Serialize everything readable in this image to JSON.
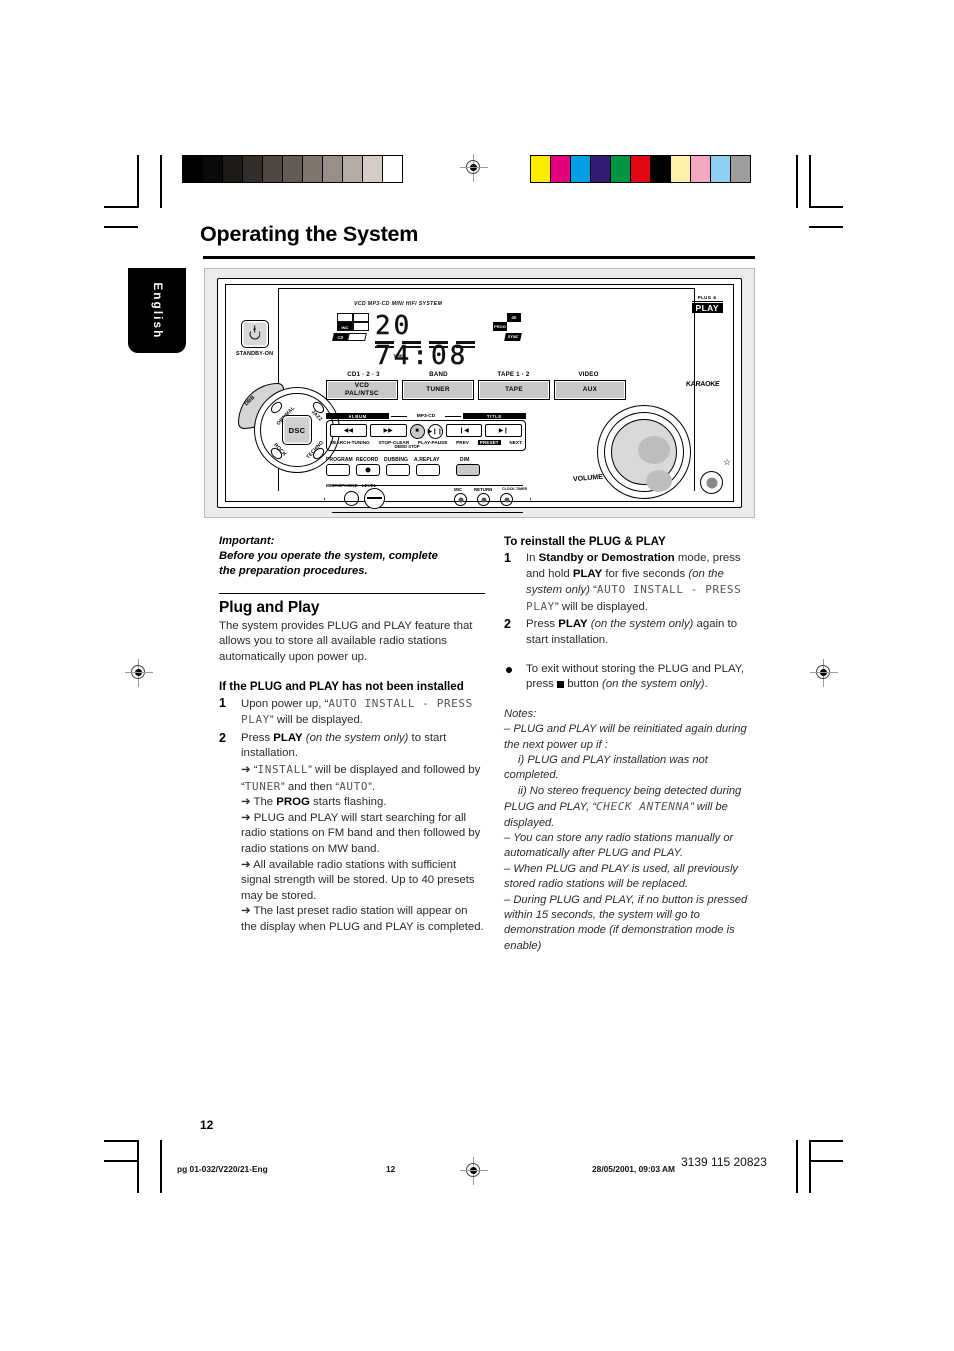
{
  "page": {
    "title": "Operating the System",
    "language_tab": "English",
    "folio": "12"
  },
  "printer_marks": {
    "grayscale_swatches": [
      "#000000",
      "#0b0a09",
      "#1d1a17",
      "#332e2a",
      "#4f4741",
      "#645b54",
      "#7e756d",
      "#998f87",
      "#b5aca4",
      "#d4cdc6",
      "#ffffff"
    ],
    "color_swatches": [
      "#fced00",
      "#e5007d",
      "#009fe3",
      "#311b74",
      "#009640",
      "#e30613",
      "#000000",
      "#fbf0a8",
      "#f6a8c0",
      "#8ed0f0",
      "#9d9d9c"
    ]
  },
  "device": {
    "system_label": "VCD MP3-CD MINI HIFI SYSTEM",
    "plug_play_logo_top": "PLUG &",
    "plug_play_logo_main": "PLAY",
    "karaoke_label": "KARAOKE",
    "standby_label": "STANDBY-ON",
    "display": {
      "track": "20",
      "time": "74:08",
      "timer_label": "TIMER",
      "icon_left_top": "INC",
      "icon_left_bottom": "CD",
      "icon_right_top": "PROG",
      "icon_right_corner": "4X",
      "icon_right_bottom": "SYNC"
    },
    "source_headers": [
      "CD1 · 2 · 3",
      "BAND",
      "TAPE 1 · 2",
      "VIDEO"
    ],
    "source_buttons": [
      "VCD\nPAL/NTSC",
      "TUNER",
      "TAPE",
      "AUX"
    ],
    "dsc": {
      "center": "DSC",
      "dbb": "DBB",
      "modes": [
        "OPTIMAL",
        "JAZZ",
        "ROCK",
        "TECHNO"
      ]
    },
    "transport": {
      "album_label": "ALBUM",
      "mp3cd_label": "MP3-CD",
      "title_label": "TITLE",
      "labels": [
        "SEARCH-TUNING",
        "STOP-CLEAR",
        "PLAY-PAUSE",
        "PREV",
        "NEXT"
      ],
      "sub_label": "DEMO STOP",
      "prev_next_mid": "PRESET"
    },
    "functions": [
      "PROGRAM",
      "RECORD",
      "DUBBING",
      "A.REPLAY",
      "DIM"
    ],
    "microphone_label": "MICROPHONE - LEVEL",
    "jack_labels": [
      "MIC",
      "RETURN",
      "CLOCK-TIMER"
    ],
    "volume_label": "VOLUME"
  },
  "left_column": {
    "important_lines": [
      "Important:",
      "Before you operate the system, complete",
      "the preparation procedures."
    ],
    "section_title": "Plug and Play",
    "intro": "The system provides PLUG and PLAY feature that allows you to store all available radio stations automatically upon power up.",
    "subheading": "If the PLUG and PLAY has not been installed",
    "steps": [
      {
        "num": "1",
        "parts": [
          {
            "t": "Upon power up, “",
            "s": "plain"
          },
          {
            "t": "AUTO INSTALL - PRESS PLAY",
            "s": "lcd"
          },
          {
            "t": "” will be displayed.",
            "s": "plain"
          }
        ]
      },
      {
        "num": "2",
        "parts": [
          {
            "t": "Press ",
            "s": "plain"
          },
          {
            "t": "PLAY",
            "s": "bold"
          },
          {
            "t": " (on the system only)",
            "s": "ital"
          },
          {
            "t": " to start installation.",
            "s": "plain"
          }
        ]
      }
    ],
    "arrows": [
      [
        {
          "t": "➔ “",
          "s": "plain"
        },
        {
          "t": "INSTALL",
          "s": "lcd"
        },
        {
          "t": "” will be displayed and followed by “",
          "s": "plain"
        },
        {
          "t": "TUNER",
          "s": "lcd"
        },
        {
          "t": "” and then “",
          "s": "plain"
        },
        {
          "t": "AUTO",
          "s": "lcd"
        },
        {
          "t": "”.",
          "s": "plain"
        }
      ],
      [
        {
          "t": "➔ The ",
          "s": "plain"
        },
        {
          "t": "PROG",
          "s": "bold"
        },
        {
          "t": " starts flashing.",
          "s": "plain"
        }
      ],
      [
        {
          "t": "➔ PLUG and PLAY will start searching for all radio stations on FM band and then followed by radio stations on MW band.",
          "s": "plain"
        }
      ],
      [
        {
          "t": "➔ All available radio stations with sufficient signal strength will be stored. Up to 40 presets may be stored.",
          "s": "plain"
        }
      ],
      [
        {
          "t": "➔ The last preset radio station will appear on the display when PLUG and PLAY is completed.",
          "s": "plain"
        }
      ]
    ]
  },
  "right_column": {
    "subheading": "To reinstall the PLUG & PLAY",
    "steps": [
      {
        "num": "1",
        "parts": [
          {
            "t": "In ",
            "s": "plain"
          },
          {
            "t": "Standby or Demostration",
            "s": "bold"
          },
          {
            "t": " mode, press and hold ",
            "s": "plain"
          },
          {
            "t": "PLAY",
            "s": "bold"
          },
          {
            "t": " for five seconds ",
            "s": "plain"
          },
          {
            "t": "(on the system only)",
            "s": "ital"
          },
          {
            "t": " “",
            "s": "plain"
          },
          {
            "t": "AUTO INSTALL - PRESS PLAY",
            "s": "lcd"
          },
          {
            "t": "” will be displayed.",
            "s": "plain"
          }
        ]
      },
      {
        "num": "2",
        "parts": [
          {
            "t": "Press ",
            "s": "plain"
          },
          {
            "t": "PLAY",
            "s": "bold"
          },
          {
            "t": " (on the system only)",
            "s": "ital"
          },
          {
            "t": " again to start installation.",
            "s": "plain"
          }
        ]
      }
    ],
    "bullet": [
      {
        "t": "To exit without storing the PLUG and PLAY, press ",
        "s": "plain"
      },
      {
        "t": "■",
        "s": "glyph"
      },
      {
        "t": " button ",
        "s": "plain"
      },
      {
        "t": "(on the system only)",
        "s": "ital"
      },
      {
        "t": ".",
        "s": "plain"
      }
    ],
    "notes_title": "Notes:",
    "notes": [
      {
        "indent": false,
        "parts": [
          {
            "t": "–  PLUG and PLAY will be reinitiated again during the next power up if :",
            "s": "plain"
          }
        ]
      },
      {
        "indent": true,
        "parts": [
          {
            "t": "i) PLUG and PLAY installation was not",
            "s": "plain"
          }
        ]
      },
      {
        "indent": false,
        "parts": [
          {
            "t": "completed.",
            "s": "plain"
          }
        ]
      },
      {
        "indent": true,
        "parts": [
          {
            "t": "ii) No stereo frequency being detected during",
            "s": "plain"
          }
        ]
      },
      {
        "indent": false,
        "parts": [
          {
            "t": "PLUG and PLAY, “",
            "s": "plain"
          },
          {
            "t": "CHECK ANTENNA",
            "s": "lcd"
          },
          {
            "t": "” will be displayed.",
            "s": "plain"
          }
        ]
      },
      {
        "indent": false,
        "parts": [
          {
            "t": "–  You can store any radio stations manually or automatically after PLUG and PLAY.",
            "s": "plain"
          }
        ]
      },
      {
        "indent": false,
        "parts": [
          {
            "t": "–  When PLUG and PLAY is used, all previously stored radio stations will be replaced.",
            "s": "plain"
          }
        ]
      },
      {
        "indent": false,
        "parts": [
          {
            "t": "–  During PLUG and PLAY, if no button is pressed within 15 seconds, the system will go to demonstration mode (if demonstration mode is enable)",
            "s": "plain"
          }
        ]
      }
    ]
  },
  "footer": {
    "file": "pg 01-032/V220/21-Eng",
    "page": "12",
    "date": "28/05/2001, 09:03 AM",
    "code": "3139 115 20823"
  }
}
